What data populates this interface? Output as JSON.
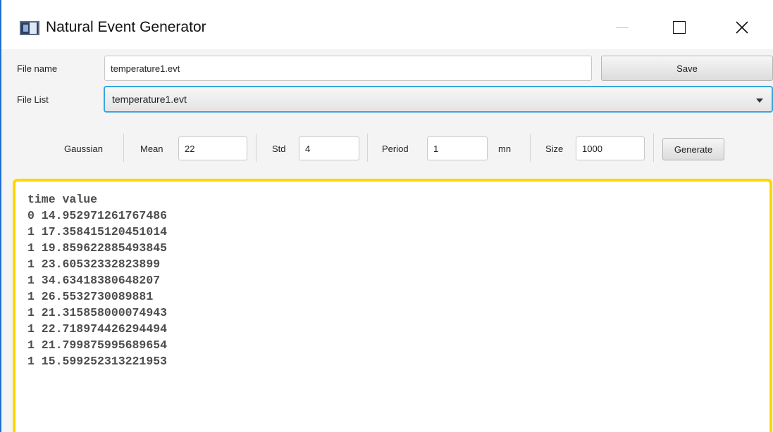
{
  "window": {
    "title": "Natural Event Generator"
  },
  "form": {
    "file_name_label": "File name",
    "file_name_value": "temperature1.evt",
    "save_label": "Save",
    "file_list_label": "File List",
    "file_list_selected": "temperature1.evt"
  },
  "generator": {
    "distribution_label": "Gaussian",
    "mean_label": "Mean",
    "mean_value": "22",
    "std_label": "Std",
    "std_value": "4",
    "period_label": "Period",
    "period_value": "1",
    "period_unit": "mn",
    "size_label": "Size",
    "size_value": "1000",
    "generate_label": "Generate"
  },
  "output": {
    "lines": [
      "time value",
      "0 14.952971261767486",
      "1 17.358415120451014",
      "1 19.859622885493845",
      "1 23.60532332823899",
      "1 34.63418380648207",
      "1 26.5532730089881",
      "1 21.315858000074943",
      "1 22.718974426294494",
      "1 21.799875995689654",
      "1 15.599252313221953"
    ]
  },
  "colors": {
    "focus_accent": "#39a5dc",
    "editor_highlight": "#ffd500",
    "window_border": "#1e6fd0"
  },
  "icons": {
    "app": "window-app-icon",
    "minimize": "minimize-icon",
    "maximize": "maximize-icon",
    "close": "close-icon",
    "dropdown": "chevron-down-icon"
  }
}
